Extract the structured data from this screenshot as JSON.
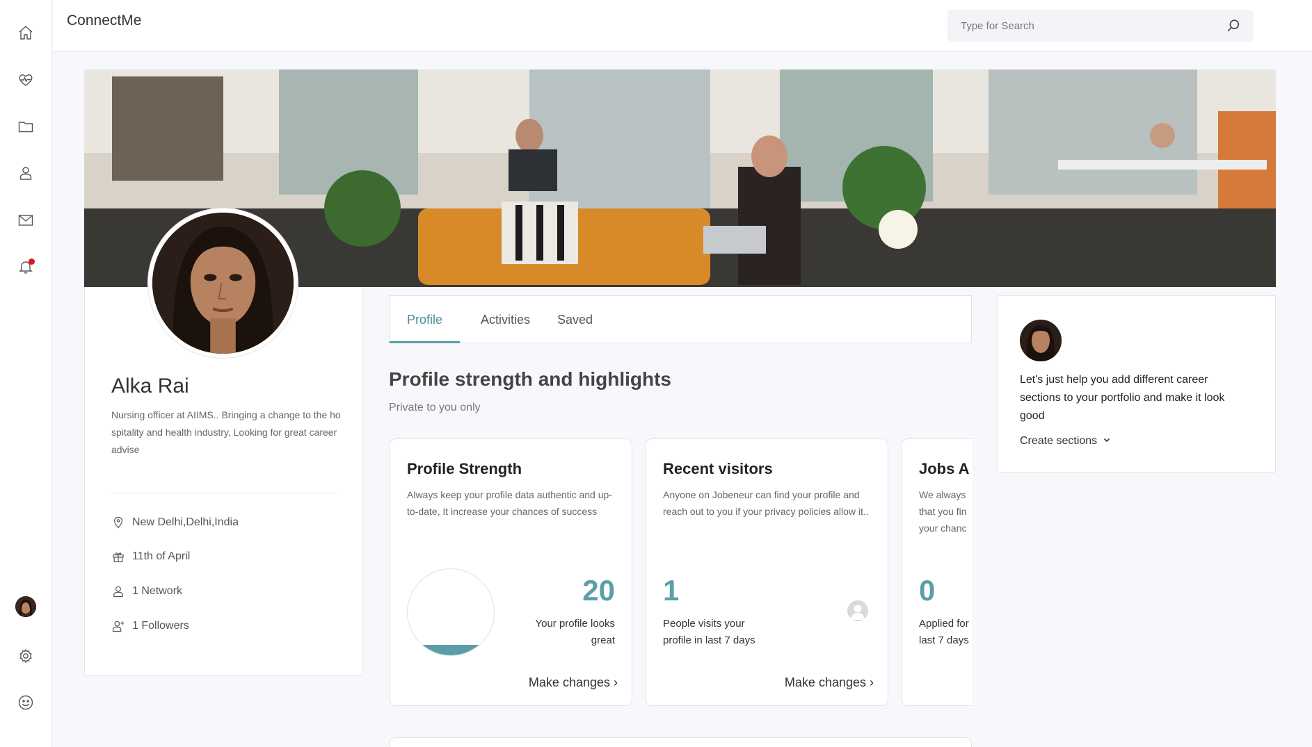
{
  "app": {
    "brand": "ConnectMe"
  },
  "search": {
    "placeholder": "Type for Search"
  },
  "rail": {
    "icons": [
      "home-icon",
      "heart-pulse-icon",
      "folder-icon",
      "user-icon",
      "mail-icon",
      "bell-icon",
      "avatar",
      "gear-icon",
      "smiley-icon"
    ],
    "notification_dot_color": "#e0141e"
  },
  "profile": {
    "name": "Alka Rai",
    "bio": "Nursing officer at AIIMS.. Bringing a change to the hospitality and health industry, Looking for great career advise",
    "location": "New Delhi,Delhi,India",
    "birthday": "11th of April",
    "network": "1 Network",
    "followers": "1 Followers"
  },
  "tabs": [
    {
      "label": "Profile",
      "active": true
    },
    {
      "label": "Activities",
      "active": false
    },
    {
      "label": "Saved",
      "active": false
    }
  ],
  "section": {
    "title": "Profile strength and highlights",
    "subtitle": "Private to you only"
  },
  "cards": {
    "strength": {
      "title": "Profile Strength",
      "desc": "Always keep your profile data authentic and up-to-date, It increase your chances of success",
      "value": "20",
      "caption": "Your profile looks great",
      "link": "Make changes",
      "ring_fill_fraction": 0.12
    },
    "visitors": {
      "title": "Recent visitors",
      "desc": "Anyone on Jobeneur can find your profile and reach out to you if your privacy policies allow it..",
      "value": "1",
      "caption": "People visits your profile in last 7 days",
      "link": "Make changes"
    },
    "jobs": {
      "title": "Jobs A",
      "desc": "We always that you fin your chanc",
      "value": "0",
      "caption": "Applied for last 7 days"
    }
  },
  "help": {
    "text": "Let's just help you add different career sections to your portfolio and make it look good",
    "link": "Create sections"
  },
  "colors": {
    "accent": "#5b9ea7",
    "border": "#e4e6ea",
    "background": "#f7f8fb"
  }
}
